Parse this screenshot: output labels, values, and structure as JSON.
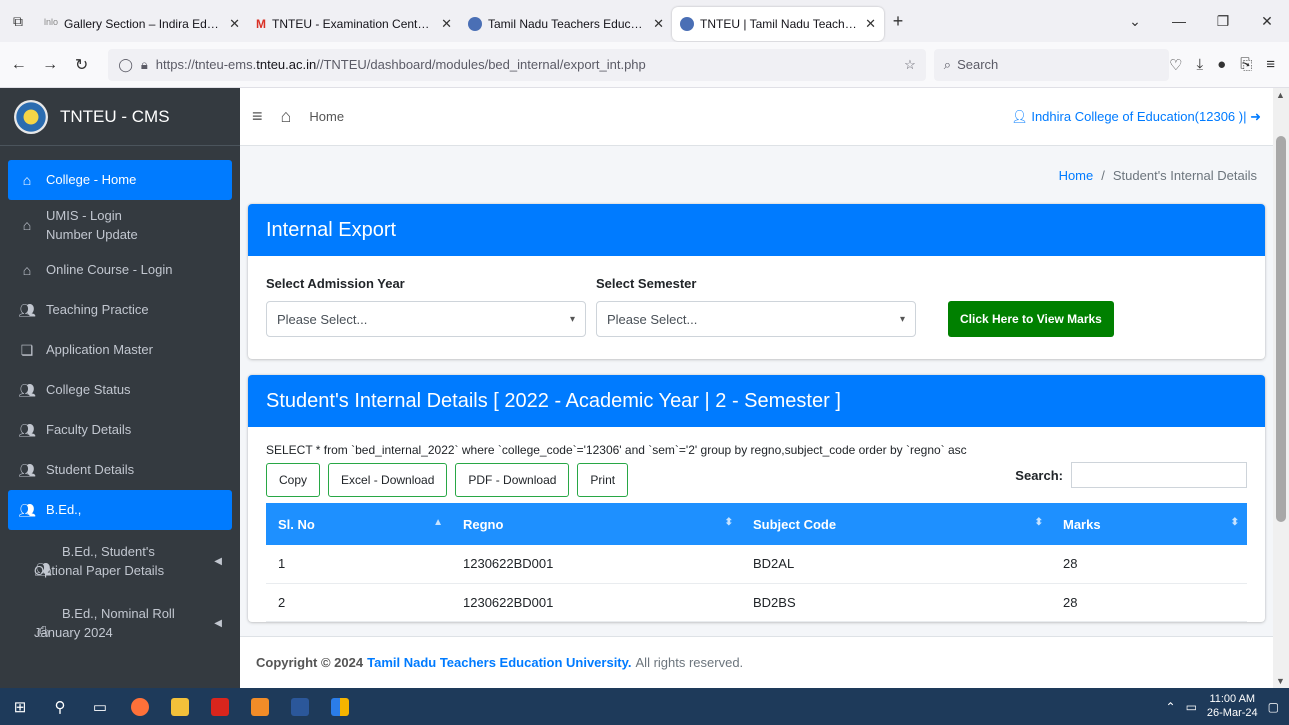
{
  "browser": {
    "tabs": [
      {
        "title": "Gallery Section – Indira Educatio",
        "active": false
      },
      {
        "title": "TNTEU - Examination Centers -",
        "active": false
      },
      {
        "title": "Tamil Nadu Teachers Education",
        "active": false
      },
      {
        "title": "TNTEU | Tamil Nadu Teachers E",
        "active": true
      }
    ],
    "url_prefix": "https://tnteu-ems.",
    "url_domain": "tnteu.ac.in",
    "url_suffix": "//TNTEU/dashboard/modules/bed_internal/export_int.php",
    "search_placeholder": "Search"
  },
  "sidebar": {
    "brand": "TNTEU - CMS",
    "items": [
      {
        "label": "College - Home",
        "icon": "home-icon",
        "active": true
      },
      {
        "label": "UMIS - Login",
        "label2": "Number Update",
        "icon": "home-icon"
      },
      {
        "label": "Online Course - Login",
        "icon": "home-icon"
      },
      {
        "label": "Teaching Practice",
        "icon": "users-icon"
      },
      {
        "label": "Application Master",
        "icon": "copy-icon"
      },
      {
        "label": "College Status",
        "icon": "users-icon"
      },
      {
        "label": "Faculty Details",
        "icon": "users-icon"
      },
      {
        "label": "Student Details",
        "icon": "users-icon"
      },
      {
        "label": "B.Ed.,",
        "icon": "users-cog-icon",
        "active": true
      },
      {
        "label": "B.Ed., Student's",
        "label2": "Optional Paper Details",
        "icon": "users-icon"
      },
      {
        "label": "B.Ed., Nominal Roll",
        "label2": "January 2024",
        "icon": "print-icon"
      }
    ]
  },
  "topnav": {
    "home_label": "Home",
    "college": "Indhira College of Education(12306 )|"
  },
  "breadcrumb": {
    "home": "Home",
    "sep": "/",
    "current": "Student's Internal Details"
  },
  "export_card": {
    "title": "Internal Export",
    "year_label": "Select Admission Year",
    "year_value": "Please Select...",
    "sem_label": "Select Semester",
    "sem_value": "Please Select...",
    "view_button": "Click Here to View Marks"
  },
  "details_card": {
    "title": "Student's Internal Details [ 2022 - Academic Year | 2 - Semester ]",
    "query": "SELECT * from `bed_internal_2022` where `college_code`='12306' and `sem`='2' group by regno,subject_code order by `regno` asc",
    "buttons": {
      "copy": "Copy",
      "excel": "Excel - Download",
      "pdf": "PDF - Download",
      "print": "Print"
    },
    "search_label": "Search:",
    "columns": [
      "Sl. No",
      "Regno",
      "Subject Code",
      "Marks"
    ],
    "rows": [
      [
        "1",
        "1230622BD001",
        "BD2AL",
        "28"
      ],
      [
        "2",
        "1230622BD001",
        "BD2BS",
        "28"
      ]
    ]
  },
  "footer": {
    "copyright": "Copyright © 2024",
    "org": "Tamil Nadu Teachers Education University.",
    "rights": "All rights reserved."
  },
  "taskbar": {
    "time": "11:00 AM",
    "date": "26-Mar-24"
  }
}
